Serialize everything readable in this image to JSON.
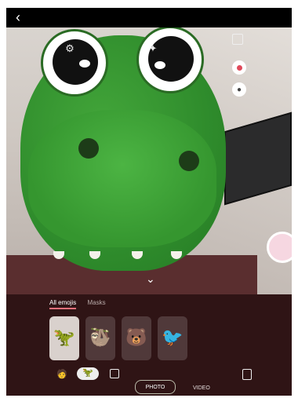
{
  "top_bar": {
    "back_icon": "arrow-left-icon",
    "back_symbol": "‹"
  },
  "viewfinder": {
    "settings_icon": "gear-icon",
    "effects_icon": "sparkle-icon",
    "side_controls": [
      "aspect-ratio-icon",
      "record-icon",
      "profile-icon"
    ],
    "collapse_symbol": "⌄"
  },
  "effects_panel": {
    "tabs": [
      "All emojis",
      "Masks"
    ],
    "selected_index": 0,
    "stickers": [
      {
        "name": "dinosaur-sticker",
        "emoji": "🦖",
        "selected": true
      },
      {
        "name": "sloth-sticker",
        "emoji": "🦥",
        "selected": false
      },
      {
        "name": "bear-sticker",
        "emoji": "🐻",
        "selected": false
      },
      {
        "name": "bird-sticker",
        "emoji": "🐦",
        "selected": false
      }
    ]
  },
  "bottom_controls": {
    "left_icons": [
      "face-emoji-icon",
      "dino-emoji-icon",
      "gallery-icon"
    ],
    "right_icon": "sticker-icon"
  },
  "modes": {
    "photo_label": "PHOTO",
    "video_label": "VIDEO"
  },
  "colors": {
    "accent": "#e9707b",
    "dino": "#35962f"
  }
}
